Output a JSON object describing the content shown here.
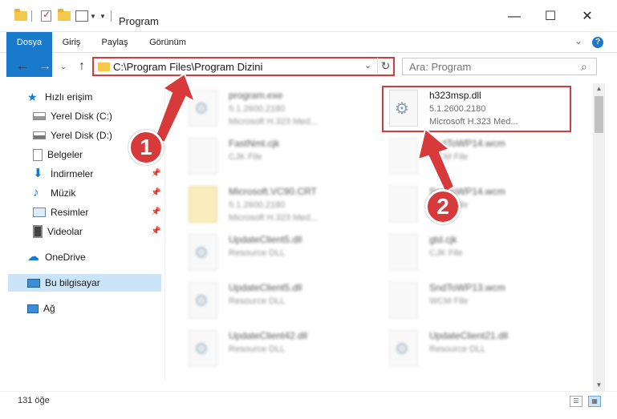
{
  "window": {
    "title": "Program",
    "minimize": "—",
    "maximize": "☐",
    "close": "✕"
  },
  "ribbon": {
    "tabs": [
      "Dosya",
      "Giriş",
      "Paylaş",
      "Görünüm"
    ],
    "help": "?"
  },
  "address": {
    "path": "C:\\Program Files\\Program Dizini",
    "search_placeholder": "Ara: Program"
  },
  "sidebar": {
    "items": [
      {
        "label": "Hızlı erişim"
      },
      {
        "label": "Yerel Disk (C:)"
      },
      {
        "label": "Yerel Disk (D:)"
      },
      {
        "label": "Belgeler"
      },
      {
        "label": "İndirmeler"
      },
      {
        "label": "Müzik"
      },
      {
        "label": "Resimler"
      },
      {
        "label": "Videolar"
      },
      {
        "label": "OneDrive"
      },
      {
        "label": "Bu bilgisayar"
      },
      {
        "label": "Ağ"
      }
    ]
  },
  "files": [
    {
      "name": "program.exe",
      "line1": "5.1.2600.2180",
      "line2": "Microsoft H.323 Med..."
    },
    {
      "name": "h323msp.dll",
      "line1": "5.1.2600.2180",
      "line2": "Microsoft H.323 Med..."
    },
    {
      "name": "FastNmt.cjk",
      "line1": "CJK File",
      "line2": ""
    },
    {
      "name": "SndToWP14.wcm",
      "line1": "WCM File",
      "line2": ""
    },
    {
      "name": "Microsoft.VC90.CRT",
      "line1": "5.1.2600.2180",
      "line2": "Microsoft H.323 Med..."
    },
    {
      "name": "SndToWP14.wcm",
      "line1": "WCM File",
      "line2": ""
    },
    {
      "name": "UpdateClient5.dll",
      "line1": "Resource DLL",
      "line2": ""
    },
    {
      "name": "gtd.cjk",
      "line1": "CJK File",
      "line2": ""
    },
    {
      "name": "UpdateClient5.dll",
      "line1": "Resource DLL",
      "line2": ""
    },
    {
      "name": "SndToWP13.wcm",
      "line1": "WCM File",
      "line2": ""
    },
    {
      "name": "UpdateClient42.dll",
      "line1": "Resource DLL",
      "line2": ""
    },
    {
      "name": "UpdateClient21.dll",
      "line1": "Resource DLL",
      "line2": ""
    }
  ],
  "annotations": {
    "marker1": "1",
    "marker2": "2"
  },
  "status": {
    "count": "131 öğe"
  },
  "colors": {
    "accent": "#1979ca",
    "highlight": "#d8393a",
    "selected": "#cce4f7"
  }
}
